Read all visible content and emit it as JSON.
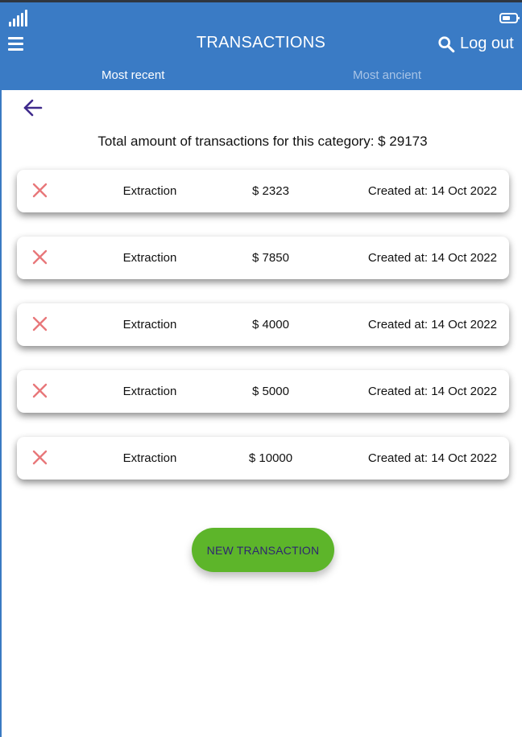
{
  "header": {
    "title": "TRANSACTIONS",
    "logout_label": "Log out"
  },
  "tabs": [
    {
      "label": "Most recent",
      "active": true
    },
    {
      "label": "Most ancient",
      "active": false
    }
  ],
  "summary": {
    "total_text": "Total amount of transactions for this category: $ 29173"
  },
  "transactions": [
    {
      "category": "Extraction",
      "amount": "$ 2323",
      "created": "Created at: 14 Oct 2022"
    },
    {
      "category": "Extraction",
      "amount": "$ 7850",
      "created": "Created at: 14 Oct 2022"
    },
    {
      "category": "Extraction",
      "amount": "$ 4000",
      "created": "Created at: 14 Oct 2022"
    },
    {
      "category": "Extraction",
      "amount": "$ 5000",
      "created": "Created at: 14 Oct 2022"
    },
    {
      "category": "Extraction",
      "amount": "$ 10000",
      "created": "Created at: 14 Oct 2022"
    }
  ],
  "actions": {
    "new_transaction_label": "NEW TRANSACTION"
  },
  "icons": {
    "menu": "hamburger-menu-icon",
    "search": "search-icon",
    "back": "arrow-left-icon",
    "delete": "close-x-icon",
    "signal": "signal-icon",
    "battery": "battery-icon"
  },
  "colors": {
    "header": "#3a7bc5",
    "tab_inactive": "#a8c4e6",
    "delete": "#e8777a",
    "button": "#5db52a",
    "button_text": "#2e2670",
    "back_arrow": "#3f2a8c"
  }
}
